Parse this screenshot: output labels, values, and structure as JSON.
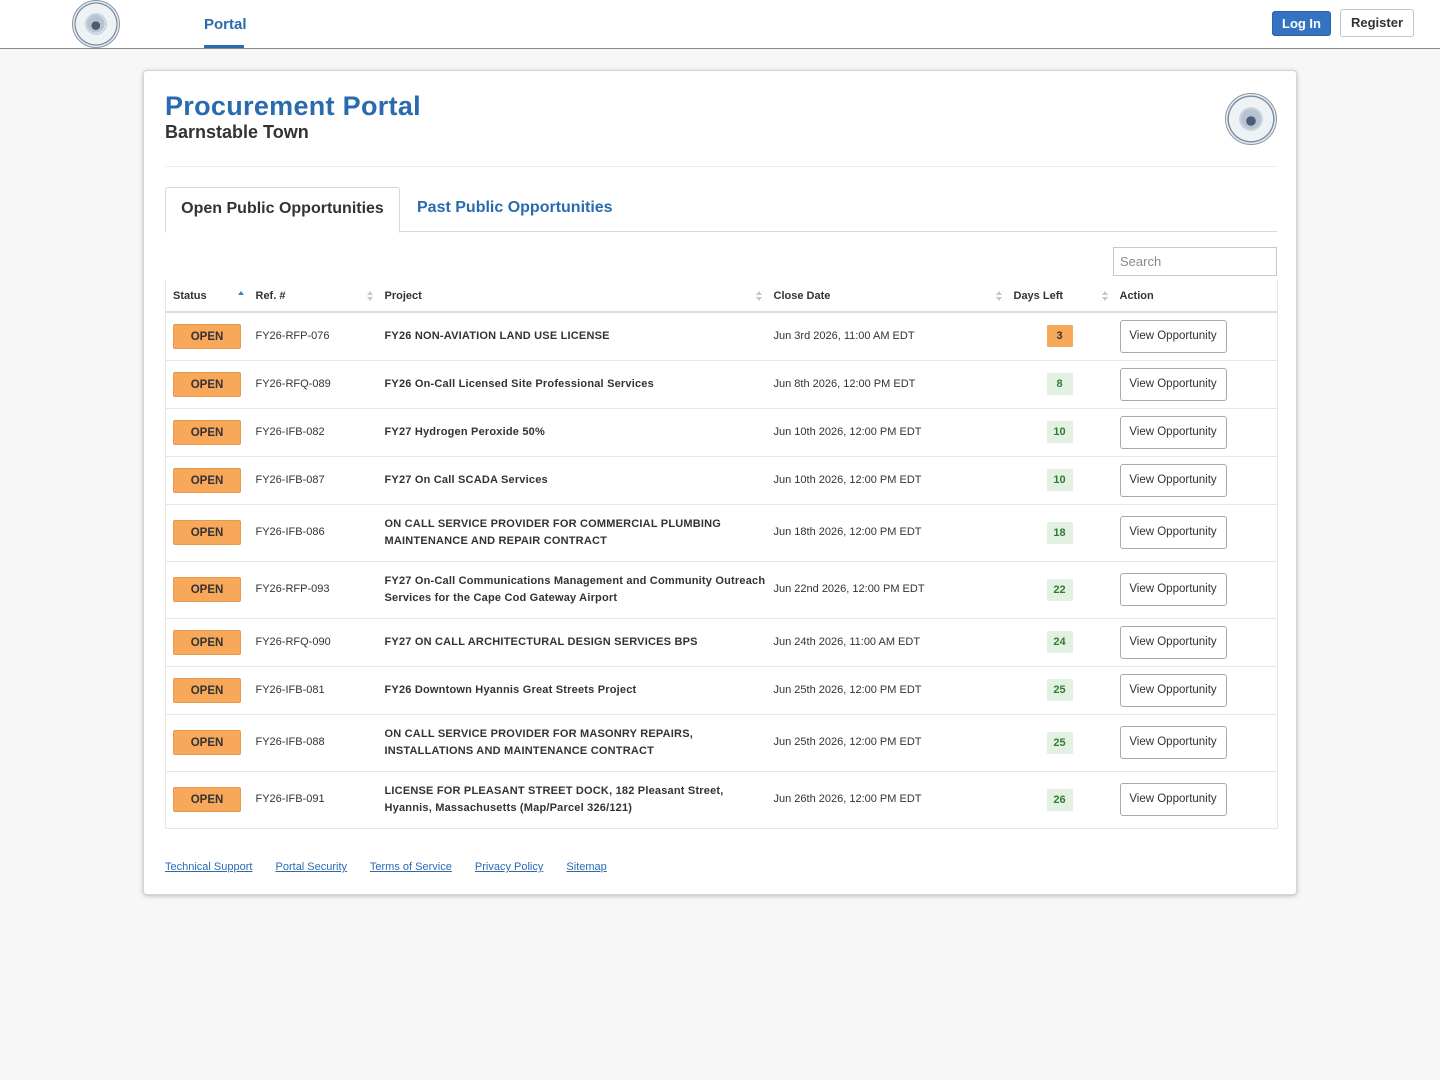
{
  "nav": {
    "tab": "Portal",
    "login_label": "Log In",
    "register_label": "Register"
  },
  "header": {
    "title": "Procurement Portal",
    "subtitle": "Barnstable Town"
  },
  "tabs": {
    "open": "Open Public Opportunities",
    "past": "Past Public Opportunities"
  },
  "search": {
    "placeholder": "Search",
    "value": ""
  },
  "columns": {
    "status": "Status",
    "ref": "Ref. #",
    "project": "Project",
    "close_date": "Close Date",
    "days_left": "Days Left",
    "action": "Action"
  },
  "rows": [
    {
      "status": "OPEN",
      "ref": "FY26-RFP-076",
      "project": "FY26 NON-AVIATION LAND USE LICENSE",
      "close_date": "Jun 3rd 2026, 11:00 AM EDT",
      "days": "3",
      "action": "View Opportunity"
    },
    {
      "status": "OPEN",
      "ref": "FY26-RFQ-089",
      "project": "FY26 On-Call Licensed Site Professional Services",
      "close_date": "Jun 8th 2026, 12:00 PM EDT",
      "days": "8",
      "action": "View Opportunity"
    },
    {
      "status": "OPEN",
      "ref": "FY26-IFB-082",
      "project": "FY27 Hydrogen Peroxide 50%",
      "close_date": "Jun 10th 2026, 12:00 PM EDT",
      "days": "10",
      "action": "View Opportunity"
    },
    {
      "status": "OPEN",
      "ref": "FY26-IFB-087",
      "project": "FY27 On Call SCADA Services",
      "close_date": "Jun 10th 2026, 12:00 PM EDT",
      "days": "10",
      "action": "View Opportunity"
    },
    {
      "status": "OPEN",
      "ref": "FY26-IFB-086",
      "project": "ON CALL SERVICE PROVIDER FOR COMMERCIAL PLUMBING MAINTENANCE AND REPAIR CONTRACT",
      "close_date": "Jun 18th 2026, 12:00 PM EDT",
      "days": "18",
      "action": "View Opportunity"
    },
    {
      "status": "OPEN",
      "ref": "FY26-RFP-093",
      "project": "FY27 On-Call Communications Management and Community Outreach Services for the Cape Cod Gateway Airport",
      "close_date": "Jun 22nd 2026, 12:00 PM EDT",
      "days": "22",
      "action": "View Opportunity"
    },
    {
      "status": "OPEN",
      "ref": "FY26-RFQ-090",
      "project": "FY27 ON CALL ARCHITECTURAL DESIGN SERVICES BPS",
      "close_date": "Jun 24th 2026, 11:00 AM EDT",
      "days": "24",
      "action": "View Opportunity"
    },
    {
      "status": "OPEN",
      "ref": "FY26-IFB-081",
      "project": "FY26 Downtown Hyannis Great Streets Project",
      "close_date": "Jun 25th 2026, 12:00 PM EDT",
      "days": "25",
      "action": "View Opportunity"
    },
    {
      "status": "OPEN",
      "ref": "FY26-IFB-088",
      "project": "ON CALL SERVICE PROVIDER FOR MASONRY REPAIRS, INSTALLATIONS AND MAINTENANCE CONTRACT",
      "close_date": "Jun 25th 2026, 12:00 PM EDT",
      "days": "25",
      "action": "View Opportunity"
    },
    {
      "status": "OPEN",
      "ref": "FY26-IFB-091",
      "project": "LICENSE FOR PLEASANT STREET DOCK, 182 Pleasant Street, Hyannis, Massachusetts (Map/Parcel 326/121)",
      "close_date": "Jun 26th 2026, 12:00 PM EDT",
      "days": "26",
      "action": "View Opportunity"
    }
  ],
  "footer": [
    "Technical Support",
    "Portal Security",
    "Terms of Service",
    "Privacy Policy",
    "Sitemap"
  ],
  "colors": {
    "accent": "#2a6bb0",
    "open_badge": "#f7a85b",
    "days_ok_bg": "#e3f1e3",
    "days_ok_text": "#2f7d32"
  }
}
